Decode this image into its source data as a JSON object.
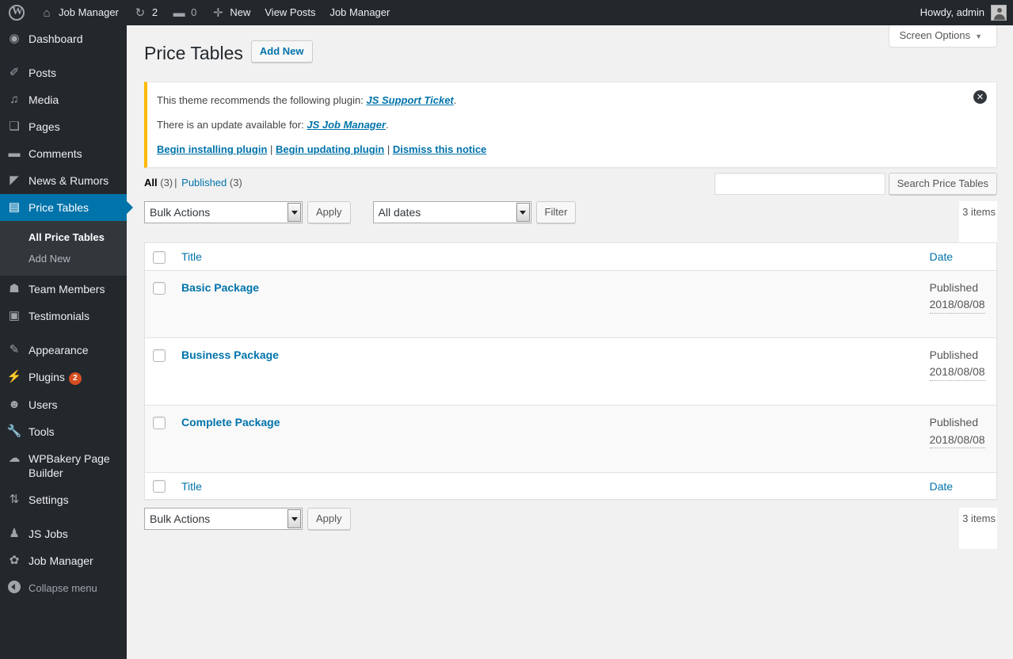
{
  "adminbar": {
    "wp_logo_icon": "wordpress-logo-icon",
    "site_name": "Job Manager",
    "site_icon": "home-icon",
    "updates_icon": "updates-icon",
    "updates_count": "2",
    "comments_icon": "comment-bubble-icon",
    "comments_count": "0",
    "new_icon": "plus-icon",
    "new_label": "New",
    "view_posts_label": "View Posts",
    "job_manager_label": "Job Manager",
    "howdy": "Howdy, admin",
    "avatar_icon": "user-avatar-icon"
  },
  "sidebar": {
    "items": [
      {
        "label": "Dashboard",
        "icon": "dashboard-icon",
        "glyph": "◉",
        "current": false,
        "sep_after": true
      },
      {
        "label": "Posts",
        "icon": "pin-icon",
        "glyph": "✐",
        "current": false,
        "sep_after": false
      },
      {
        "label": "Media",
        "icon": "media-icon",
        "glyph": "♫",
        "current": false,
        "sep_after": false
      },
      {
        "label": "Pages",
        "icon": "pages-icon",
        "glyph": "❏",
        "current": false,
        "sep_after": false
      },
      {
        "label": "Comments",
        "icon": "comment-bubble-icon",
        "glyph": "▬",
        "current": false,
        "sep_after": false
      },
      {
        "label": "News & Rumors",
        "icon": "megaphone-icon",
        "glyph": "◤",
        "current": false,
        "sep_after": false
      },
      {
        "label": "Price Tables",
        "icon": "price-table-icon",
        "glyph": "▤",
        "current": true,
        "sep_after": false
      },
      {
        "label": "Team Members",
        "icon": "group-icon",
        "glyph": "☗",
        "current": false,
        "sep_after": false
      },
      {
        "label": "Testimonials",
        "icon": "testimonial-icon",
        "glyph": "▣",
        "current": false,
        "sep_after": true
      },
      {
        "label": "Appearance",
        "icon": "brush-icon",
        "glyph": "✎",
        "current": false,
        "sep_after": false
      },
      {
        "label": "Plugins",
        "icon": "plug-icon",
        "glyph": "⚡",
        "current": false,
        "badge": "2",
        "sep_after": false
      },
      {
        "label": "Users",
        "icon": "user-icon",
        "glyph": "☻",
        "current": false,
        "sep_after": false
      },
      {
        "label": "Tools",
        "icon": "wrench-icon",
        "glyph": "🔧",
        "current": false,
        "sep_after": false
      },
      {
        "label": "WPBakery Page Builder",
        "icon": "cloud-icon",
        "glyph": "☁",
        "current": false,
        "sep_after": false
      },
      {
        "label": "Settings",
        "icon": "settings-sliders-icon",
        "glyph": "⇅",
        "current": false,
        "sep_after": true
      },
      {
        "label": "JS Jobs",
        "icon": "tie-icon",
        "glyph": "♟",
        "current": false,
        "sep_after": false
      },
      {
        "label": "Job Manager",
        "icon": "gear-icon",
        "glyph": "✿",
        "current": false,
        "sep_after": false
      }
    ],
    "submenu": {
      "parent": "Price Tables",
      "items": [
        {
          "label": "All Price Tables",
          "current": true
        },
        {
          "label": "Add New",
          "current": false
        }
      ]
    },
    "collapse_label": "Collapse menu",
    "collapse_icon": "collapse-arrow-icon",
    "active_color": "#0073aa",
    "background_color": "#23282d",
    "submenu_background": "#32373c",
    "badge_color": "#d54e21"
  },
  "screen_meta": {
    "screen_options_label": "Screen Options",
    "caret": "▼"
  },
  "page": {
    "title": "Price Tables",
    "add_new_label": "Add New"
  },
  "notice": {
    "line1_text": "This theme recommends the following plugin: ",
    "line1_link": "JS Support Ticket",
    "line1_tail": ".",
    "line2_text": "There is an update available for: ",
    "line2_link": "JS Job Manager",
    "line2_tail": ".",
    "action1": "Begin installing plugin",
    "sep1": " | ",
    "action2": "Begin updating plugin",
    "sep2": " | ",
    "action3": "Dismiss this notice",
    "dismiss_icon": "close-circle-icon",
    "dismiss_glyph": "✕",
    "accent_color": "#ffb900"
  },
  "views": {
    "all_label": "All",
    "all_count": "(3)",
    "divider": "|",
    "published_label": "Published",
    "published_count": "(3)"
  },
  "search": {
    "value": "",
    "placeholder": "",
    "button_label": "Search Price Tables"
  },
  "tablenav_top": {
    "bulk_actions_selected": "Bulk Actions",
    "apply_label": "Apply",
    "dates_selected": "All dates",
    "filter_label": "Filter",
    "displaying_num": "3 items"
  },
  "tablenav_bottom": {
    "bulk_actions_selected": "Bulk Actions",
    "apply_label": "Apply",
    "displaying_num": "3 items"
  },
  "table": {
    "columns": {
      "title": "Title",
      "date": "Date"
    },
    "rows": [
      {
        "title": "Basic Package",
        "status": "Published",
        "date": "2018/08/08"
      },
      {
        "title": "Business Package",
        "status": "Published",
        "date": "2018/08/08"
      },
      {
        "title": "Complete Package",
        "status": "Published",
        "date": "2018/08/08"
      }
    ]
  }
}
